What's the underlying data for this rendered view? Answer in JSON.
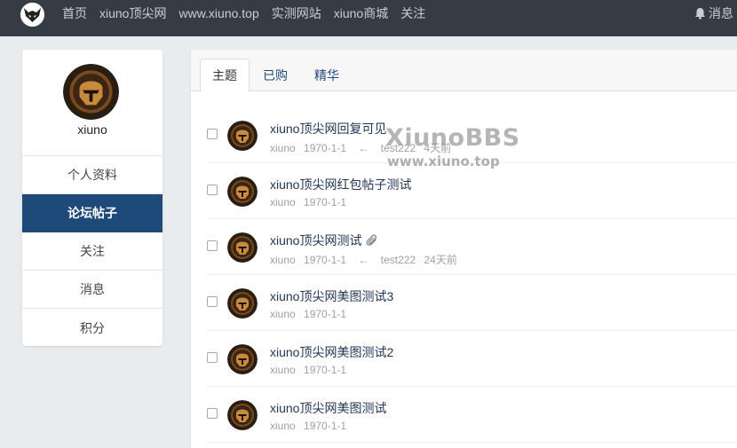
{
  "nav": {
    "links": [
      "首页",
      "xiuno顶尖网",
      "www.xiuno.top",
      "实测网站",
      "xiuno商城",
      "关注"
    ],
    "messages_label": "消息"
  },
  "sidebar": {
    "username": "xiuno",
    "menu": [
      {
        "label": "个人资料",
        "active": false
      },
      {
        "label": "论坛帖子",
        "active": true
      },
      {
        "label": "关注",
        "active": false
      },
      {
        "label": "消息",
        "active": false
      },
      {
        "label": "积分",
        "active": false
      }
    ]
  },
  "tabs": [
    {
      "label": "主题",
      "active": true
    },
    {
      "label": "已购",
      "active": false
    },
    {
      "label": "精华",
      "active": false
    }
  ],
  "threads": [
    {
      "title": "xiuno顶尖网回复可见",
      "author": "xiuno",
      "date": "1970-1-1",
      "reply_arrow": "←",
      "last_user": "test222",
      "last_time": "4天前",
      "attachment": false
    },
    {
      "title": "xiuno顶尖网红包帖子测试",
      "author": "xiuno",
      "date": "1970-1-1",
      "attachment": false
    },
    {
      "title": "xiuno顶尖网测试",
      "author": "xiuno",
      "date": "1970-1-1",
      "reply_arrow": "←",
      "last_user": "test222",
      "last_time": "24天前",
      "attachment": true
    },
    {
      "title": "xiuno顶尖网美图测试3",
      "author": "xiuno",
      "date": "1970-1-1",
      "attachment": false
    },
    {
      "title": "xiuno顶尖网美图测试2",
      "author": "xiuno",
      "date": "1970-1-1",
      "attachment": false
    },
    {
      "title": "xiuno顶尖网美图测试",
      "author": "xiuno",
      "date": "1970-1-1",
      "attachment": false
    }
  ],
  "watermark": {
    "line1": "XiunoBBS",
    "line2": "www.xiuno.top"
  },
  "icons": {
    "logo": "wolf-logo-icon",
    "bell": "bell-icon",
    "avatar": "helmet-avatar-icon",
    "attachment": "paperclip-icon"
  },
  "colors": {
    "topbar": "#363c44",
    "active_menu": "#1e4a7a",
    "link": "#23375a",
    "meta": "#a0a0a0"
  }
}
